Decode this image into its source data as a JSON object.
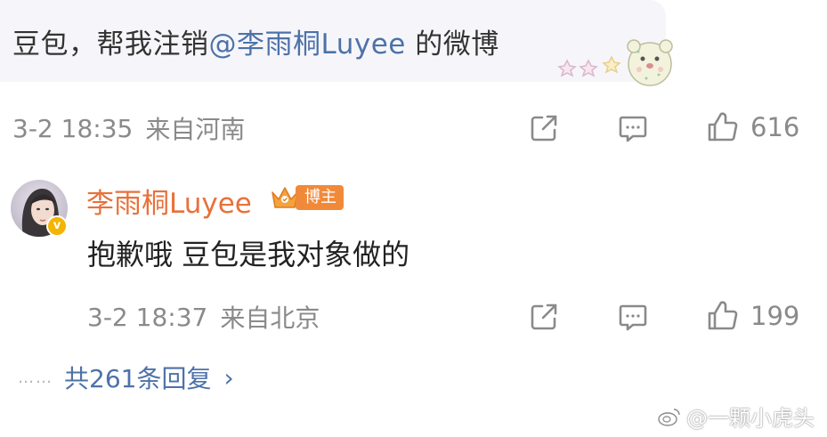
{
  "comment": {
    "text_prefix": "豆包，帮我注销",
    "mention": "@李雨桐Luyee",
    "text_suffix": " 的微博",
    "time": "3-2 18:35",
    "location": "来自河南",
    "like_count": "616"
  },
  "reply": {
    "author": "李雨桐Luyee",
    "badge": "博主",
    "text": "抱歉哦 豆包是我对象做的",
    "time": "3-2 18:37",
    "location": "来自北京",
    "like_count": "199"
  },
  "more_replies": {
    "dots": "……",
    "label": "共261条回复",
    "chevron": "›"
  },
  "watermark": {
    "text": "@一颗小虎头"
  },
  "colors": {
    "mention": "#4d72a8",
    "author": "#e8713a",
    "badge": "#f08a3a",
    "meta": "#8a8a8a"
  },
  "icons": [
    "share-icon",
    "comment-icon",
    "like-icon",
    "crown-icon",
    "verified-icon",
    "weibo-logo-icon"
  ]
}
